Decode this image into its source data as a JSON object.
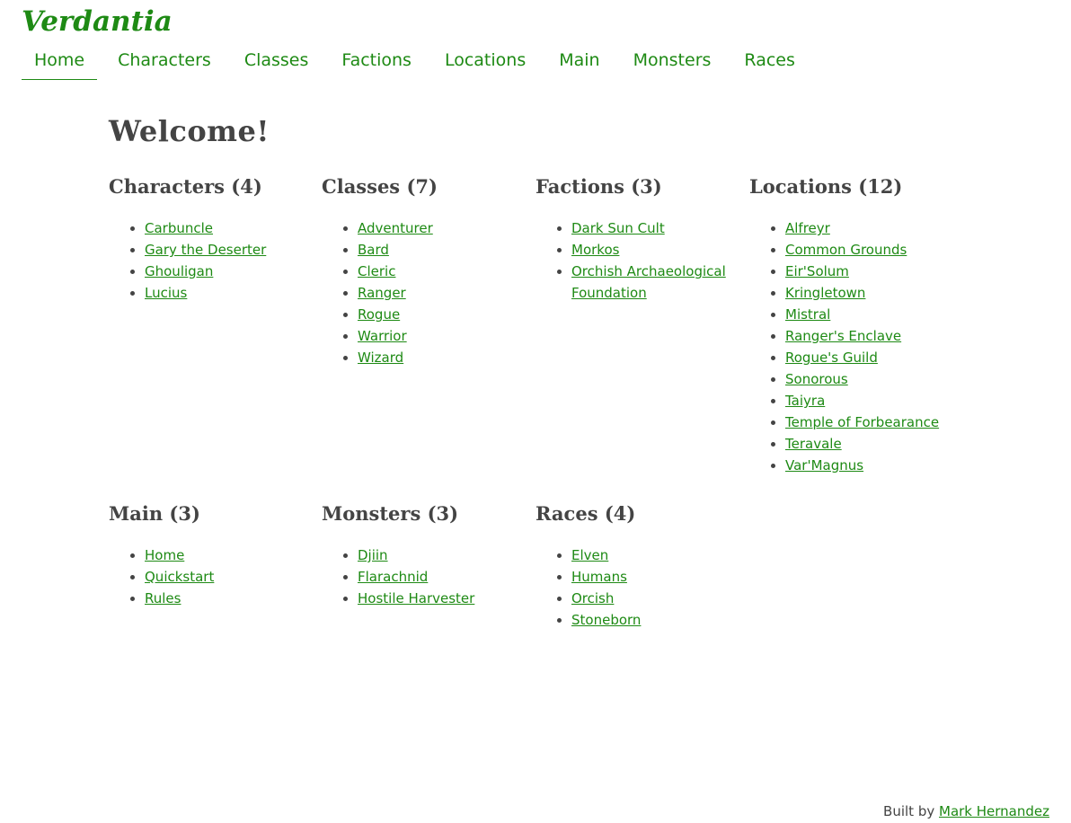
{
  "site": {
    "title": "Verdantia"
  },
  "nav": [
    {
      "label": "Home",
      "active": true
    },
    {
      "label": "Characters"
    },
    {
      "label": "Classes"
    },
    {
      "label": "Factions"
    },
    {
      "label": "Locations"
    },
    {
      "label": "Main"
    },
    {
      "label": "Monsters"
    },
    {
      "label": "Races"
    }
  ],
  "main": {
    "heading": "Welcome!",
    "sections": [
      {
        "title": "Characters (4)",
        "items": [
          "Carbuncle",
          "Gary the Deserter",
          "Ghouligan",
          "Lucius"
        ]
      },
      {
        "title": "Classes (7)",
        "items": [
          "Adventurer",
          "Bard",
          "Cleric",
          "Ranger",
          "Rogue",
          "Warrior",
          "Wizard"
        ]
      },
      {
        "title": "Factions (3)",
        "items": [
          "Dark Sun Cult",
          "Morkos",
          "Orchish Archaeological Foundation"
        ]
      },
      {
        "title": "Locations (12)",
        "items": [
          "Alfreyr",
          "Common Grounds",
          "Eir'Solum",
          "Kringletown",
          "Mistral",
          "Ranger's Enclave",
          "Rogue's Guild",
          "Sonorous",
          "Taiyra",
          "Temple of Forbearance",
          "Teravale",
          "Var'Magnus"
        ]
      },
      {
        "title": "Main (3)",
        "items": [
          "Home",
          "Quickstart",
          "Rules"
        ]
      },
      {
        "title": "Monsters (3)",
        "items": [
          "Djiin",
          "Flarachnid",
          "Hostile Harvester"
        ]
      },
      {
        "title": "Races (4)",
        "items": [
          "Elven",
          "Humans",
          "Orcish",
          "Stoneborn"
        ]
      }
    ]
  },
  "footer": {
    "prefix": "Built by",
    "author": "Mark Hernandez"
  },
  "colors": {
    "accent": "#1e8a14",
    "text": "#444444"
  }
}
